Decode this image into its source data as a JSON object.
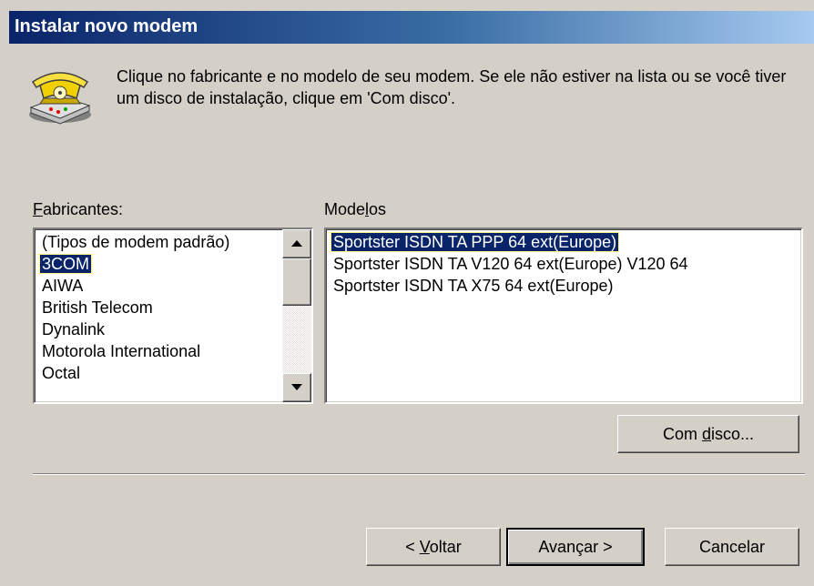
{
  "window": {
    "title": "Instalar novo modem"
  },
  "instructions": "Clique no fabricante e no modelo de seu modem. Se ele não estiver na lista ou se você tiver um disco de instalação, clique em 'Com disco'.",
  "manufacturers": {
    "label_prefix": "",
    "label_accel": "F",
    "label_rest": "abricantes:",
    "items": [
      {
        "label": "(Tipos de modem padrão)",
        "selected": false
      },
      {
        "label": "3COM",
        "selected": true
      },
      {
        "label": "AIWA",
        "selected": false
      },
      {
        "label": "British Telecom",
        "selected": false
      },
      {
        "label": "Dynalink",
        "selected": false
      },
      {
        "label": "Motorola International",
        "selected": false
      },
      {
        "label": "Octal",
        "selected": false
      }
    ]
  },
  "models": {
    "label_prefix": "Mode",
    "label_accel": "l",
    "label_rest": "os",
    "items": [
      {
        "label": "Sportster ISDN TA PPP 64 ext(Europe)",
        "selected": true
      },
      {
        "label": "Sportster ISDN TA V120 64 ext(Europe) V120 64",
        "selected": false
      },
      {
        "label": "Sportster ISDN TA X75 64 ext(Europe)",
        "selected": false
      }
    ]
  },
  "buttons": {
    "have_disk": {
      "prefix": "Com ",
      "accel": "d",
      "rest": "isco..."
    },
    "back": {
      "prefix": "< ",
      "accel": "V",
      "rest": "oltar"
    },
    "next": {
      "label": "Avançar >"
    },
    "cancel": {
      "label": "Cancelar"
    }
  },
  "colors": {
    "selection": "#0a246a",
    "dialog_bg": "#d4d0c8",
    "title_start": "#0a246a",
    "title_end": "#a6caf0"
  },
  "icons": {
    "header": "telephone-modem-icon"
  }
}
